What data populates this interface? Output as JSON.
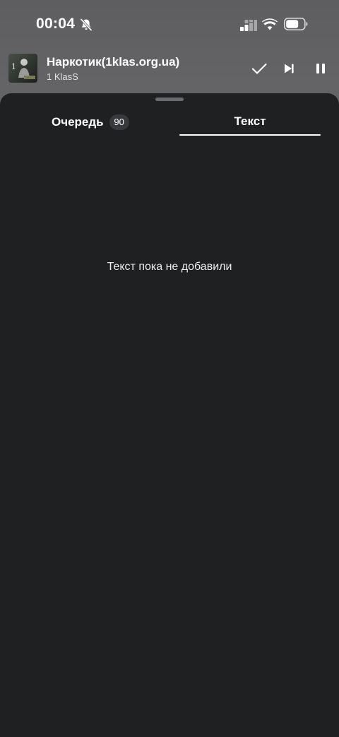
{
  "status_bar": {
    "time": "00:04",
    "icons": [
      "bell-muted-icon",
      "cellular-signal-icon",
      "wifi-icon",
      "battery-icon"
    ]
  },
  "mini_player": {
    "title": "Наркотик(1klas.org.ua)",
    "artist": "1 KlasS",
    "album_art_icon": "album-art",
    "controls": [
      "check-icon",
      "skip-next-icon",
      "pause-icon"
    ]
  },
  "sheet": {
    "tabs": [
      {
        "label": "Очередь",
        "badge": "90",
        "selected": false
      },
      {
        "label": "Текст",
        "selected": true
      }
    ],
    "empty_message": "Текст пока не добавили"
  },
  "colors": {
    "sheet_background": "#1f2022",
    "badge_background": "#38393c",
    "text_primary": "#ffffff",
    "grabber": "#6a6b6e"
  }
}
